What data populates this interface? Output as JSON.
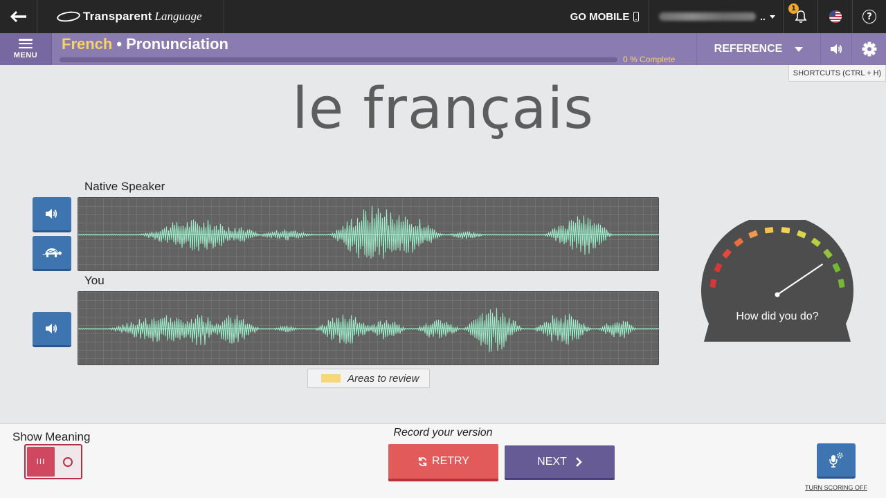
{
  "topbar": {
    "brand_main": "Transparent",
    "brand_italic": "Language",
    "go_mobile": "GO MOBILE",
    "user_ellipsis": "..",
    "notification_count": "1",
    "help": "?"
  },
  "header": {
    "language": "French",
    "separator": "•",
    "activity": "Pronunciation",
    "menu_label": "MENU",
    "progress_percent": 0,
    "progress_text": "0 % Complete",
    "reference_label": "REFERENCE",
    "shortcuts_tip": "SHORTCUTS  (CTRL + H)"
  },
  "main": {
    "word": "le français",
    "native_label": "Native Speaker",
    "you_label": "You",
    "legend": "Areas to review",
    "gauge_prompt": "How did you do?",
    "gauge_score_fraction": 0.85
  },
  "bottom": {
    "show_meaning": "Show Meaning",
    "toggle_on_glyph": "III",
    "record_prompt": "Record your version",
    "retry": "RETRY",
    "next": "NEXT",
    "turn_scoring_off": "TURN SCORING OFF"
  },
  "colors": {
    "accent_purple": "#8a7bb0",
    "language_yellow": "#f6d36a",
    "action_blue": "#3e74b0",
    "retry_red": "#e25a5a",
    "next_purple": "#675b96",
    "waveform": "#9ff0cc"
  },
  "icons": {
    "back": "arrow-left-icon",
    "phone": "phone-icon",
    "bell": "bell-icon",
    "flag": "us-flag-icon",
    "menu": "hamburger-icon",
    "speaker": "speaker-icon",
    "turtle": "turtle-icon",
    "gear": "gear-icon",
    "refresh": "refresh-icon",
    "chevron": "chevron-right-icon",
    "mic": "mic-settings-icon"
  }
}
